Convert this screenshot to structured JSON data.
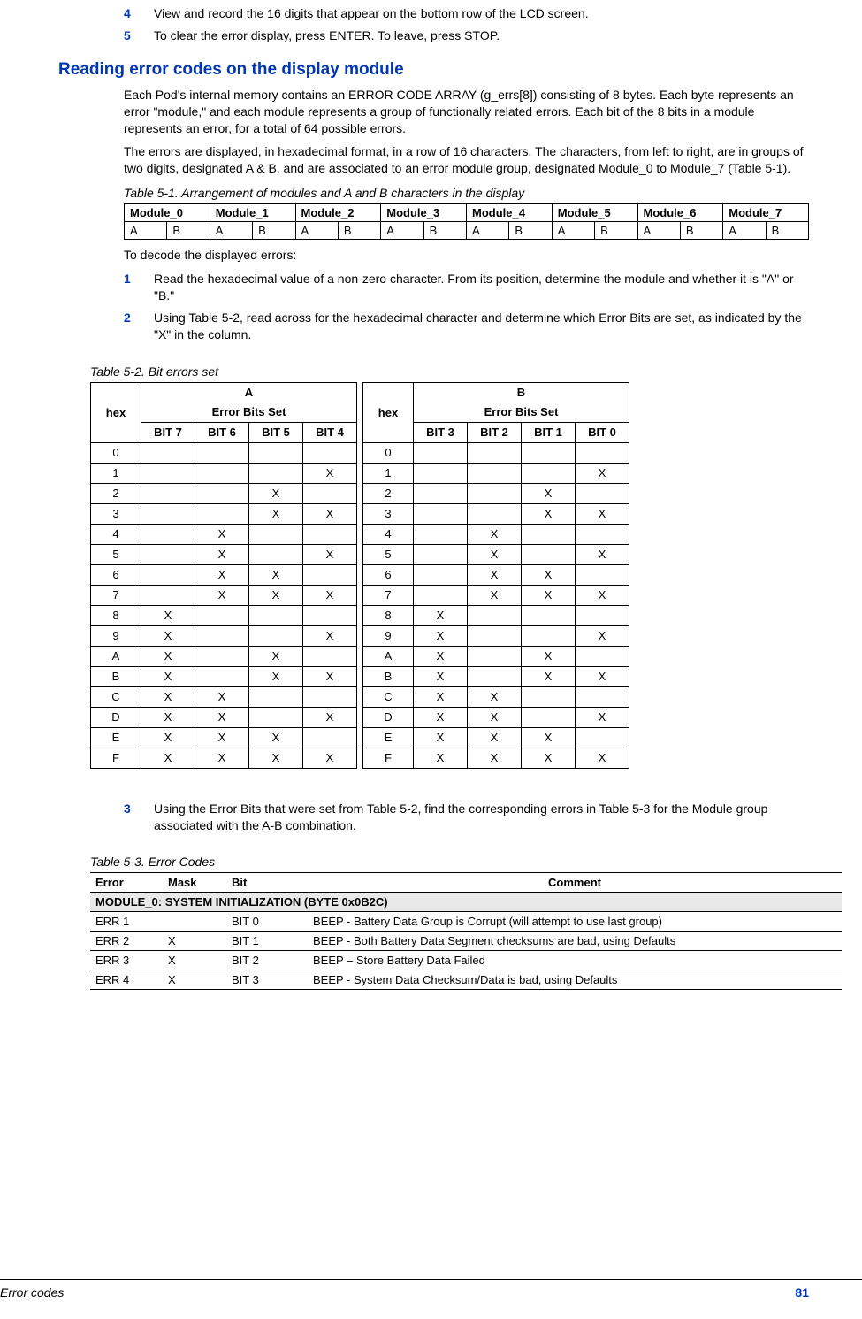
{
  "intro_steps": [
    {
      "n": "4",
      "t": "View and record the 16 digits that appear on the bottom row of the LCD screen."
    },
    {
      "n": "5",
      "t": "To clear the error display, press ENTER. To leave, press STOP."
    }
  ],
  "section_title": "Reading error codes on the display module",
  "para1": "Each Pod's internal memory contains an ERROR CODE ARRAY (g_errs[8]) consisting of 8 bytes. Each byte represents an error \"module,\" and each module represents a group of functionally related errors. Each bit of the 8 bits in a module represents an error, for a total of 64 possible errors.",
  "para2": "The errors are displayed, in hexadecimal format, in a row of 16 characters. The characters, from left to right, are in groups of two digits, designated A & B, and are associated to an error module group, designated Module_0 to Module_7 (Table 5-1).",
  "t51_caption": "Table 5-1. Arrangement of modules and A and B characters in the display",
  "t51_modules": [
    "Module_0",
    "Module_1",
    "Module_2",
    "Module_3",
    "Module_4",
    "Module_5",
    "Module_6",
    "Module_7"
  ],
  "t51_row": [
    "A",
    "B",
    "A",
    "B",
    "A",
    "B",
    "A",
    "B",
    "A",
    "B",
    "A",
    "B",
    "A",
    "B",
    "A",
    "B"
  ],
  "para3": "To decode the displayed errors:",
  "decode_steps": [
    {
      "n": "1",
      "t": "Read the hexadecimal value of a non-zero character. From its position, determine the module and whether it is \"A\" or \"B.\""
    },
    {
      "n": "2",
      "t": "Using Table 5-2, read across for the hexadecimal character and determine which Error Bits are set, as indicated by the \"X\" in the column."
    }
  ],
  "t52_caption": "Table 5-2. Bit errors set",
  "t52": {
    "hexA": "hex",
    "titleA": "A",
    "subtitleA": "Error Bits Set",
    "bitsA": [
      "BIT 7",
      "BIT 6",
      "BIT 5",
      "BIT 4"
    ],
    "hexB": "hex",
    "titleB": "B",
    "subtitleB": "Error Bits Set",
    "bitsB": [
      "BIT 3",
      "BIT 2",
      "BIT 1",
      "BIT 0"
    ],
    "rows": [
      {
        "h": "0",
        "a": [
          "",
          "",
          "",
          ""
        ],
        "b": [
          "",
          "",
          "",
          ""
        ]
      },
      {
        "h": "1",
        "a": [
          "",
          "",
          "",
          "X"
        ],
        "b": [
          "",
          "",
          "",
          "X"
        ]
      },
      {
        "h": "2",
        "a": [
          "",
          "",
          "X",
          ""
        ],
        "b": [
          "",
          "",
          "X",
          ""
        ]
      },
      {
        "h": "3",
        "a": [
          "",
          "",
          "X",
          "X"
        ],
        "b": [
          "",
          "",
          "X",
          "X"
        ]
      },
      {
        "h": "4",
        "a": [
          "",
          "X",
          "",
          ""
        ],
        "b": [
          "",
          "X",
          "",
          ""
        ]
      },
      {
        "h": "5",
        "a": [
          "",
          "X",
          "",
          "X"
        ],
        "b": [
          "",
          "X",
          "",
          "X"
        ]
      },
      {
        "h": "6",
        "a": [
          "",
          "X",
          "X",
          ""
        ],
        "b": [
          "",
          "X",
          "X",
          ""
        ]
      },
      {
        "h": "7",
        "a": [
          "",
          "X",
          "X",
          "X"
        ],
        "b": [
          "",
          "X",
          "X",
          "X"
        ]
      },
      {
        "h": "8",
        "a": [
          "X",
          "",
          "",
          ""
        ],
        "b": [
          "X",
          "",
          "",
          ""
        ]
      },
      {
        "h": "9",
        "a": [
          "X",
          "",
          "",
          "X"
        ],
        "b": [
          "X",
          "",
          "",
          "X"
        ]
      },
      {
        "h": "A",
        "a": [
          "X",
          "",
          "X",
          ""
        ],
        "b": [
          "X",
          "",
          "X",
          ""
        ]
      },
      {
        "h": "B",
        "a": [
          "X",
          "",
          "X",
          "X"
        ],
        "b": [
          "X",
          "",
          "X",
          "X"
        ]
      },
      {
        "h": "C",
        "a": [
          "X",
          "X",
          "",
          ""
        ],
        "b": [
          "X",
          "X",
          "",
          ""
        ]
      },
      {
        "h": "D",
        "a": [
          "X",
          "X",
          "",
          "X"
        ],
        "b": [
          "X",
          "X",
          "",
          "X"
        ]
      },
      {
        "h": "E",
        "a": [
          "X",
          "X",
          "X",
          ""
        ],
        "b": [
          "X",
          "X",
          "X",
          ""
        ]
      },
      {
        "h": "F",
        "a": [
          "X",
          "X",
          "X",
          "X"
        ],
        "b": [
          "X",
          "X",
          "X",
          "X"
        ]
      }
    ]
  },
  "step3": {
    "n": "3",
    "t": "Using the Error Bits that were set from Table 5-2, find the corresponding errors in Table 5-3 for the Module group associated with the A-B combination."
  },
  "t53_caption": "Table 5-3. Error Codes",
  "t53": {
    "headers": [
      "Error",
      "Mask",
      "Bit",
      "Comment"
    ],
    "modrow": "MODULE_0: SYSTEM INITIALIZATION (BYTE 0x0B2C)",
    "rows": [
      {
        "e": "ERR 1",
        "m": "",
        "b": "BIT 0",
        "c": "BEEP - Battery Data Group is Corrupt (will attempt to use last group)"
      },
      {
        "e": "ERR 2",
        "m": "X",
        "b": "BIT 1",
        "c": "BEEP - Both Battery Data Segment checksums are bad, using Defaults"
      },
      {
        "e": "ERR 3",
        "m": "X",
        "b": "BIT 2",
        "c": "BEEP – Store Battery Data Failed"
      },
      {
        "e": "ERR 4",
        "m": "X",
        "b": "BIT 3",
        "c": "BEEP - System Data Checksum/Data is bad, using Defaults"
      }
    ]
  },
  "footer": {
    "left": "Error codes",
    "right": "81"
  }
}
